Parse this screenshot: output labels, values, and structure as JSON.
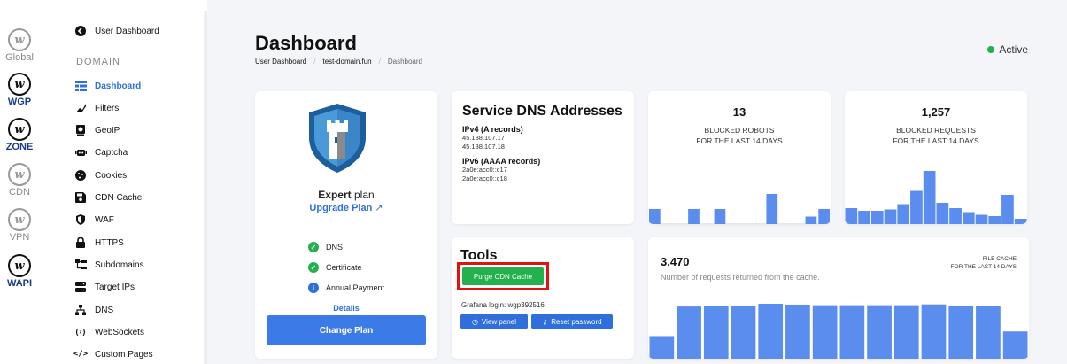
{
  "rail": [
    {
      "label": "Global",
      "active": false
    },
    {
      "label": "WGP",
      "active": true
    },
    {
      "label": "ZONE",
      "active": true
    },
    {
      "label": "CDN",
      "active": false
    },
    {
      "label": "VPN",
      "active": false
    },
    {
      "label": "WAPI",
      "active": true
    }
  ],
  "nav": {
    "user_dashboard": "User Dashboard",
    "section": "Domain",
    "items": [
      {
        "label": "Dashboard",
        "icon": "dashboard-icon"
      },
      {
        "label": "Filters",
        "icon": "filter-icon"
      },
      {
        "label": "GeoIP",
        "icon": "geoip-icon"
      },
      {
        "label": "Captcha",
        "icon": "robot-icon"
      },
      {
        "label": "Cookies",
        "icon": "cookie-icon"
      },
      {
        "label": "CDN Cache",
        "icon": "save-icon"
      },
      {
        "label": "WAF",
        "icon": "shield-icon"
      },
      {
        "label": "HTTPS",
        "icon": "lock-icon"
      },
      {
        "label": "Subdomains",
        "icon": "subdomains-icon"
      },
      {
        "label": "Target IPs",
        "icon": "server-icon"
      },
      {
        "label": "DNS",
        "icon": "network-icon"
      },
      {
        "label": "WebSockets",
        "icon": "websocket-icon"
      },
      {
        "label": "Custom Pages",
        "icon": "code-icon"
      }
    ]
  },
  "header": {
    "title": "Dashboard",
    "breadcrumb": [
      "User Dashboard",
      "test-domain.fun",
      "Dashboard"
    ],
    "status": "Active",
    "status_color": "#22b14c"
  },
  "plan": {
    "name_bold": "Expert",
    "name_rest": " plan",
    "upgrade": "Upgrade Plan",
    "features": [
      {
        "label": "DNS",
        "icon": "check-icon"
      },
      {
        "label": "Certificate",
        "icon": "check-icon"
      },
      {
        "label": "Annual Payment",
        "icon": "info-icon"
      }
    ],
    "details": "Details",
    "change": "Change Plan"
  },
  "dns": {
    "title": "Service DNS Addresses",
    "ipv4_label": "IPv4 (A records)",
    "ipv4": [
      "45.138.107.17",
      "45.138.107.18"
    ],
    "ipv6_label": "IPv6 (AAAA records)",
    "ipv6": [
      "2a0e:acc0::c17",
      "2a0e:acc0::c18"
    ]
  },
  "tools": {
    "title": "Tools",
    "purge": "Purge CDN Cache",
    "grafana": "Grafana login: wgp392516",
    "view_panel": "View panel",
    "reset_password": "Reset password"
  },
  "stats": {
    "robots": {
      "value": "13",
      "line1": "BLOCKED ROBOTS",
      "line2": "FOR THE LAST 14 DAYS"
    },
    "requests": {
      "value": "1,257",
      "line1": "BLOCKED REQUESTS",
      "line2": "FOR THE LAST 14 DAYS"
    },
    "cache": {
      "value": "3,470",
      "desc": "Number of requests returned from the cache.",
      "tag1": "FILE CACHE",
      "tag2": "FOR THE LAST 14 DAYS"
    }
  },
  "chart_data": [
    {
      "type": "bar",
      "title": "BLOCKED ROBOTS",
      "values": [
        2,
        0,
        0,
        2,
        0,
        2,
        0,
        0,
        0,
        4,
        0,
        0,
        1,
        2
      ],
      "color": "#5b8def"
    },
    {
      "type": "bar",
      "title": "BLOCKED REQUESTS",
      "values": [
        12,
        10,
        10,
        11,
        15,
        25,
        40,
        16,
        12,
        9,
        7,
        6,
        22,
        4
      ],
      "color": "#5b8def"
    },
    {
      "type": "bar",
      "title": "FILE CACHE",
      "values": [
        108,
        249,
        250,
        250,
        262,
        258,
        255,
        255,
        255,
        255,
        259,
        253,
        250,
        130
      ],
      "color": "#5b8def"
    }
  ]
}
